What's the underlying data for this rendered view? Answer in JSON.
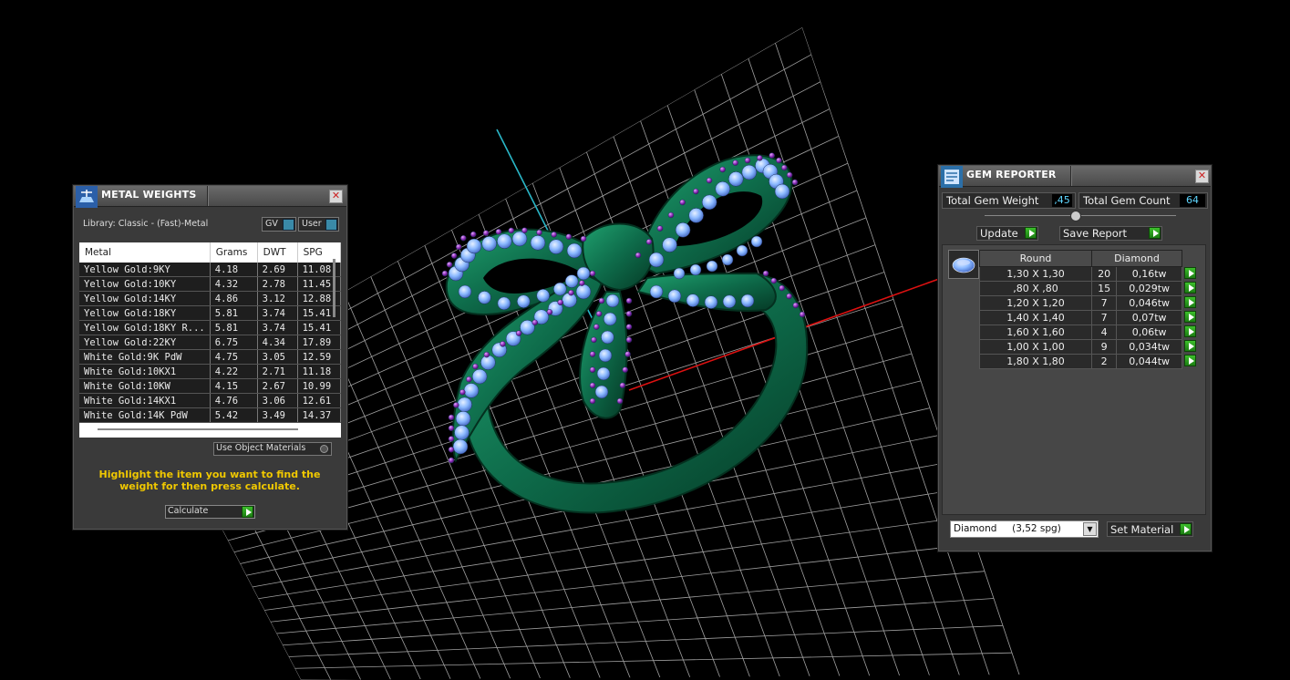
{
  "metal_weights": {
    "title": "METAL WEIGHTS",
    "library": "Library: Classic - (Fast)-Metal",
    "gv_label": "GV",
    "user_label": "User",
    "columns": [
      "Metal",
      "Grams",
      "DWT",
      "SPG"
    ],
    "rows": [
      [
        "Yellow Gold:9KY",
        "4.18",
        "2.69",
        "11.08"
      ],
      [
        "Yellow Gold:10KY",
        "4.32",
        "2.78",
        "11.45"
      ],
      [
        "Yellow Gold:14KY",
        "4.86",
        "3.12",
        "12.88"
      ],
      [
        "Yellow Gold:18KY",
        "5.81",
        "3.74",
        "15.41"
      ],
      [
        "Yellow Gold:18KY R...",
        "5.81",
        "3.74",
        "15.41"
      ],
      [
        "Yellow Gold:22KY",
        "6.75",
        "4.34",
        "17.89"
      ],
      [
        "White Gold:9K PdW",
        "4.75",
        "3.05",
        "12.59"
      ],
      [
        "White Gold:10KX1",
        "4.22",
        "2.71",
        "11.18"
      ],
      [
        "White Gold:10KW",
        "4.15",
        "2.67",
        "10.99"
      ],
      [
        "White Gold:14KX1",
        "4.76",
        "3.06",
        "12.61"
      ],
      [
        "White Gold:14K PdW",
        "5.42",
        "3.49",
        "14.37"
      ]
    ],
    "use_object_materials": "Use Object Materials",
    "instruction": "Highlight the item you want to find the weight for then press calculate.",
    "calculate_label": "Calculate"
  },
  "gem_reporter": {
    "title": "GEM REPORTER",
    "total_weight_label": "Total Gem Weight",
    "total_weight_value": ",45",
    "total_count_label": "Total Gem Count",
    "total_count_value": "64",
    "update_label": "Update",
    "save_report_label": "Save Report",
    "columns": [
      "Round",
      "Diamond"
    ],
    "rows": [
      [
        "1,30 X 1,30",
        "20",
        "0,16tw"
      ],
      [
        ",80 X ,80",
        "15",
        "0,029tw"
      ],
      [
        "1,20 X 1,20",
        "7",
        "0,046tw"
      ],
      [
        "1,40 X 1,40",
        "7",
        "0,07tw"
      ],
      [
        "1,60 X 1,60",
        "4",
        "0,06tw"
      ],
      [
        "1,00 X 1,00",
        "9",
        "0,034tw"
      ],
      [
        "1,80 X 1,80",
        "2",
        "0,044tw"
      ]
    ],
    "material_select": "Diamond     (3,52 spg)",
    "set_material_label": "Set Material"
  },
  "colors": {
    "instruction_text": "#f0c800",
    "value_text": "#5fd6ff",
    "ring_metal": "#0e6b4a",
    "gem_light": "#8ab8ff",
    "gem_purple": "#8a2fb8"
  }
}
